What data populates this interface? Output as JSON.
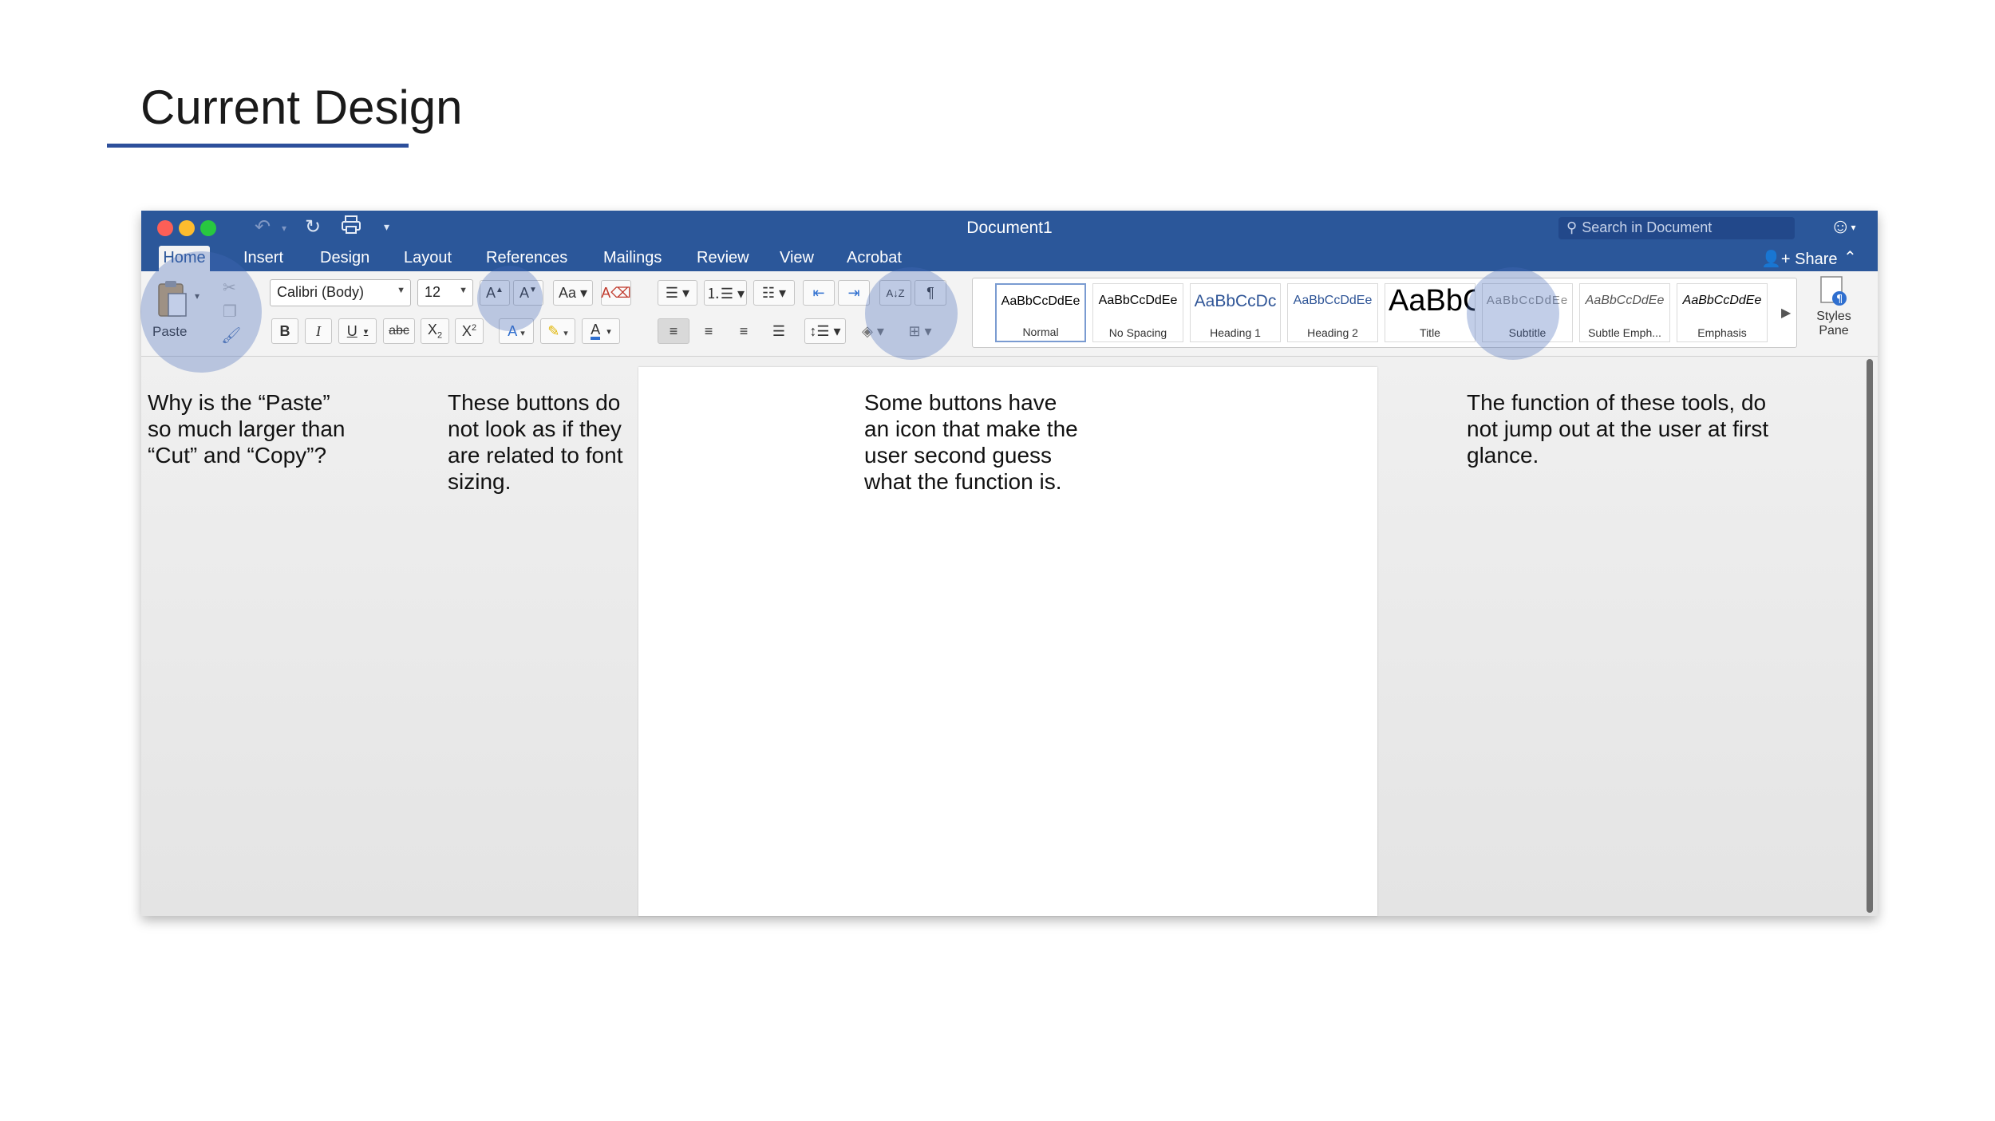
{
  "slide": {
    "title": "Current Design"
  },
  "window": {
    "title": "Document1",
    "search_placeholder": "Search in Document",
    "share_label": "Share",
    "tabs": [
      "Home",
      "Insert",
      "Design",
      "Layout",
      "References",
      "Mailings",
      "Review",
      "View",
      "Acrobat"
    ]
  },
  "ribbon": {
    "paste_label": "Paste",
    "font_name": "Calibri (Body)",
    "font_size": "12",
    "styles": [
      {
        "preview": "AaBbCcDdEe",
        "name": "Normal"
      },
      {
        "preview": "AaBbCcDdEe",
        "name": "No Spacing"
      },
      {
        "preview": "AaBbCcDc",
        "name": "Heading 1"
      },
      {
        "preview": "AaBbCcDdEe",
        "name": "Heading 2"
      },
      {
        "preview": "AaBbC",
        "name": "Title"
      },
      {
        "preview": "AaBbCcDdEe",
        "name": "Subtitle"
      },
      {
        "preview": "AaBbCcDdEe",
        "name": "Subtle Emph..."
      },
      {
        "preview": "AaBbCcDdEe",
        "name": "Emphasis"
      }
    ],
    "styles_pane_label": "Styles Pane",
    "icons": {
      "undo": "undo-icon",
      "redo": "redo-icon",
      "print": "print-icon",
      "customize": "customize-quick-access-icon",
      "cut": "scissors-icon",
      "copy": "copy-icon",
      "format_painter": "format-painter-icon"
    }
  },
  "annotations": [
    "Why is the “Paste” so much larger than “Cut” and “Copy”?",
    "These buttons do not look as if they are related to font sizing.",
    "Some buttons have an icon that make the user second guess what the function is.",
    "The function of these tools, do not jump out at the user at first glance."
  ],
  "colors": {
    "title_bar": "#2b579a",
    "underline": "#2d4f9b",
    "highlight": "#4669b9"
  }
}
